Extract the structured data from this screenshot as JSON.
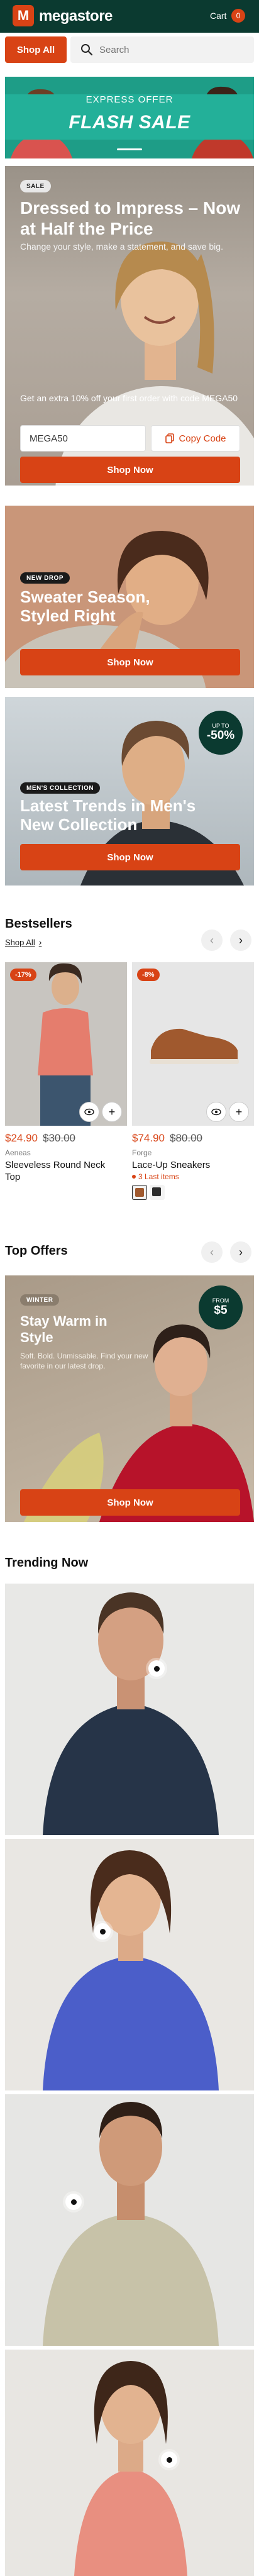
{
  "header": {
    "brand": "megastore",
    "logo_letter": "M",
    "cart_label": "Cart",
    "cart_count": "0"
  },
  "search": {
    "shop_all": "Shop All",
    "placeholder": "Search"
  },
  "flash": {
    "top": "EXPRESS OFFER",
    "title": "FLASH SALE"
  },
  "promo1": {
    "pill": "SALE",
    "title": "Dressed to Impress – Now at Half the Price",
    "subtitle": "Change your style, make a statement, and save big.",
    "code_text": "Get an extra 10% off your first order with code MEGA50",
    "code_value": "MEGA50",
    "copy_label": "Copy Code",
    "cta": "Shop Now"
  },
  "promo2": {
    "pill": "NEW DROP",
    "title": "Sweater Season, Styled Right",
    "cta": "Shop Now"
  },
  "promo3": {
    "pill": "MEN'S COLLECTION",
    "title": "Latest Trends in Men's New Collection",
    "cta": "Shop Now",
    "badge_top": "UP TO",
    "badge_value": "-50%"
  },
  "bestsellers": {
    "title": "Bestsellers",
    "shop_all": "Shop All",
    "products": [
      {
        "discount": "-17%",
        "price": "$24.90",
        "old_price": "$30.00",
        "brand": "Aeneas",
        "name": "Sleeveless Round Neck Top",
        "stock": ""
      },
      {
        "discount": "-8%",
        "price": "$74.90",
        "old_price": "$80.00",
        "brand": "Forge",
        "name": "Lace-Up Sneakers",
        "stock": "3 Last items"
      }
    ]
  },
  "top_offers": {
    "title": "Top Offers",
    "pill": "WINTER",
    "card_title": "Stay Warm in Style",
    "card_sub": "Soft. Bold. Unmissable. Find your new favorite in our latest drop.",
    "badge_top": "FROM",
    "badge_value": "$5",
    "cta": "Shop Now"
  },
  "trending": {
    "title": "Trending Now"
  },
  "colors": {
    "primary": "#d84315",
    "header": "#0b3a30",
    "teal": "#1e9d87"
  }
}
